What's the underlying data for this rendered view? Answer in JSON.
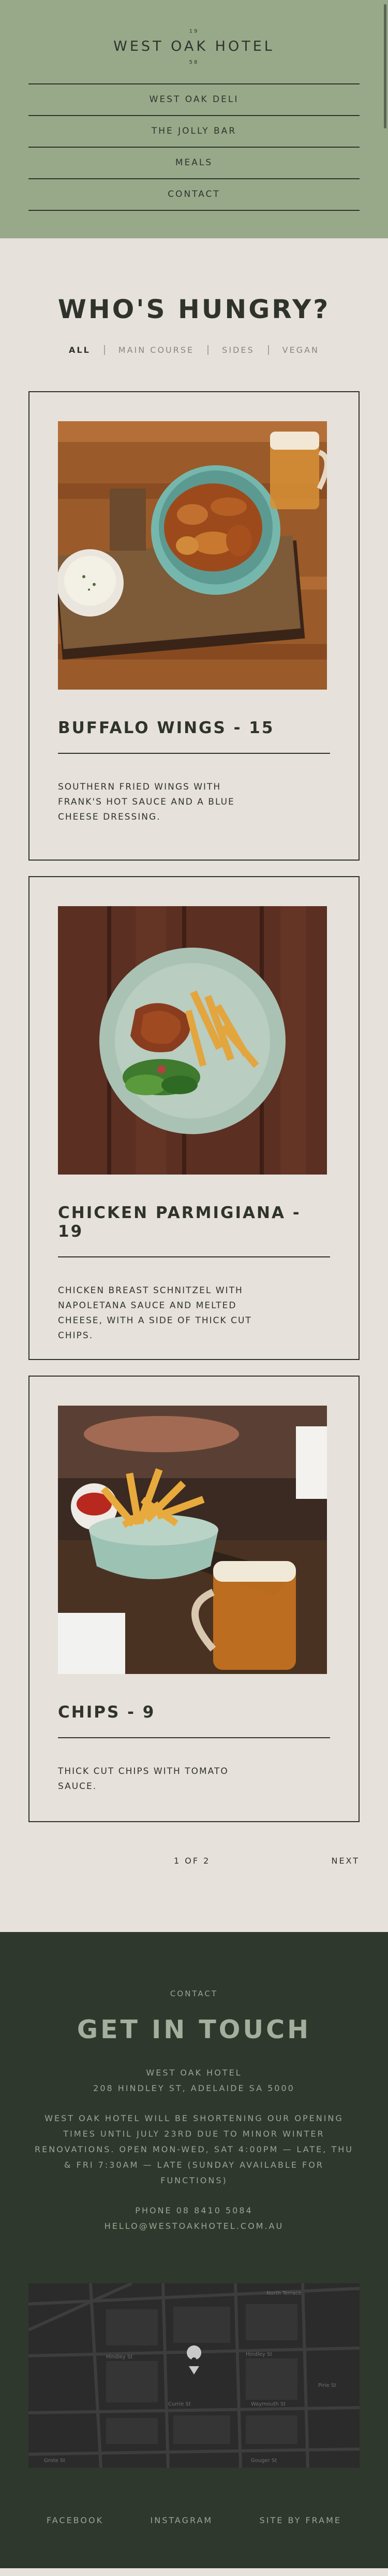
{
  "header": {
    "logo_top": "19",
    "logo_name": "WEST OAK HOTEL",
    "logo_bottom": "58",
    "nav": [
      "WEST OAK DELI",
      "THE JOLLY BAR",
      "MEALS",
      "CONTACT"
    ]
  },
  "menu": {
    "title": "WHO'S HUNGRY?",
    "filters": [
      "ALL",
      "MAIN COURSE",
      "SIDES",
      "VEGAN"
    ],
    "items": [
      {
        "title": "BUFFALO WINGS - 15",
        "desc": "SOUTHERN FRIED WINGS WITH FRANK'S HOT SAUCE AND A BLUE CHEESE DRESSING."
      },
      {
        "title": "CHICKEN PARMIGIANA - 19",
        "desc": "CHICKEN BREAST SCHNITZEL WITH NAPOLETANA SAUCE AND MELTED CHEESE, WITH A SIDE OF THICK CUT CHIPS."
      },
      {
        "title": "CHIPS - 9",
        "desc": "THICK CUT CHIPS WITH TOMATO SAUCE."
      }
    ],
    "page_indicator": "1 OF 2",
    "next_label": "NEXT"
  },
  "footer": {
    "label": "CONTACT",
    "title": "GET IN TOUCH",
    "venue": "WEST OAK HOTEL",
    "address": "208 HINDLEY ST, ADELAIDE SA 5000",
    "notice": "WEST OAK HOTEL WILL BE SHORTENING OUR OPENING TIMES UNTIL JULY 23RD DUE TO MINOR WINTER RENOVATIONS. OPEN MON-WED, SAT 4:00PM — LATE, THU & FRI 7:30AM — LATE (SUNDAY AVAILABLE FOR FUNCTIONS)",
    "phone": "PHONE 08 8410 5084",
    "email": "HELLO@WESTOAKHOTEL.COM.AU",
    "map_labels": [
      "North Terrace",
      "Hindley St",
      "Grote St",
      "Gouger St",
      "Currie St",
      "Waymouth St",
      "Pirie St"
    ],
    "socials": [
      "FACEBOOK",
      "INSTAGRAM",
      "SITE BY FRAME"
    ]
  },
  "colors": {
    "header_bg": "#98a98a",
    "body_bg": "#e6e1db",
    "footer_bg": "#2f382c",
    "ink": "#2f332c"
  }
}
